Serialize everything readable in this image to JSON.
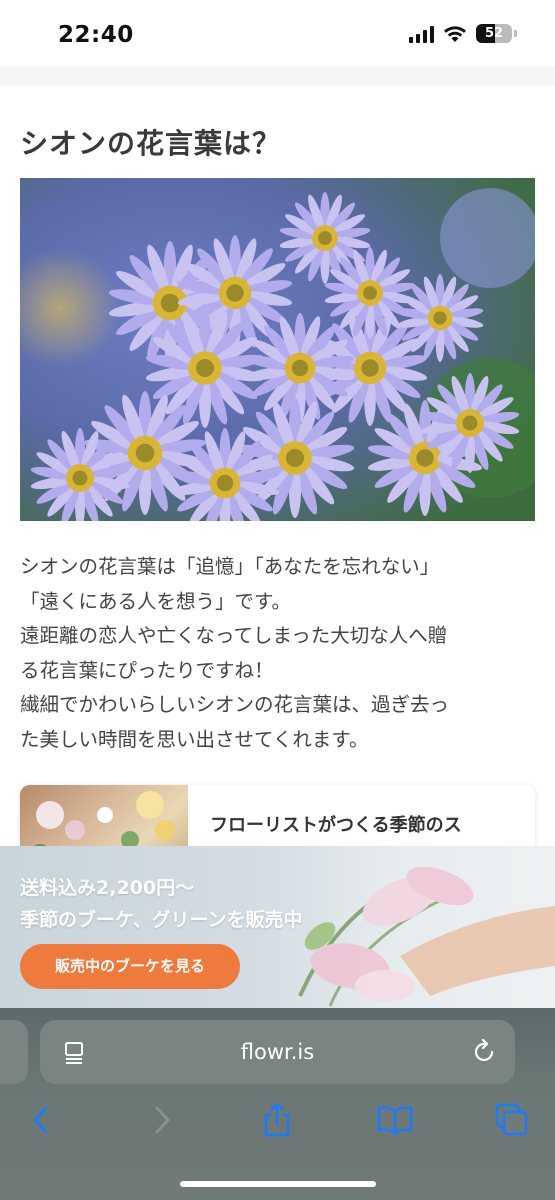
{
  "status": {
    "time": "22:40",
    "battery": "52",
    "battery_level": 0.52
  },
  "article": {
    "title": "シオンの花言葉は？",
    "hero_alt": "",
    "paragraph_lines": [
      "シオンの花言葉は「追憶」「あなたを忘れない」",
      "「遠くにある人を想う」です。",
      "遠距離の恋人や亡くなってしまった大切な人へ贈",
      "る花言葉にぴったりですね！",
      "繊細でかわいらしいシオンの花言葉は、過ぎ去っ",
      "た美しい時間を思い出させてくれます。"
    ]
  },
  "related_card": {
    "title": "フローリストがつくる季節のス"
  },
  "promo": {
    "line1": "送料込み2,200円〜",
    "line2": "季節のブーケ、グリーンを販売中",
    "button": "販売中のブーケを見る",
    "accent": "#ee7a3e"
  },
  "browser": {
    "url": "flowr.is",
    "icons": [
      "page-menu-icon",
      "reload-icon",
      "back-icon",
      "forward-icon",
      "share-icon",
      "bookmarks-icon",
      "tabs-icon"
    ],
    "accent": "#1a7aff"
  }
}
